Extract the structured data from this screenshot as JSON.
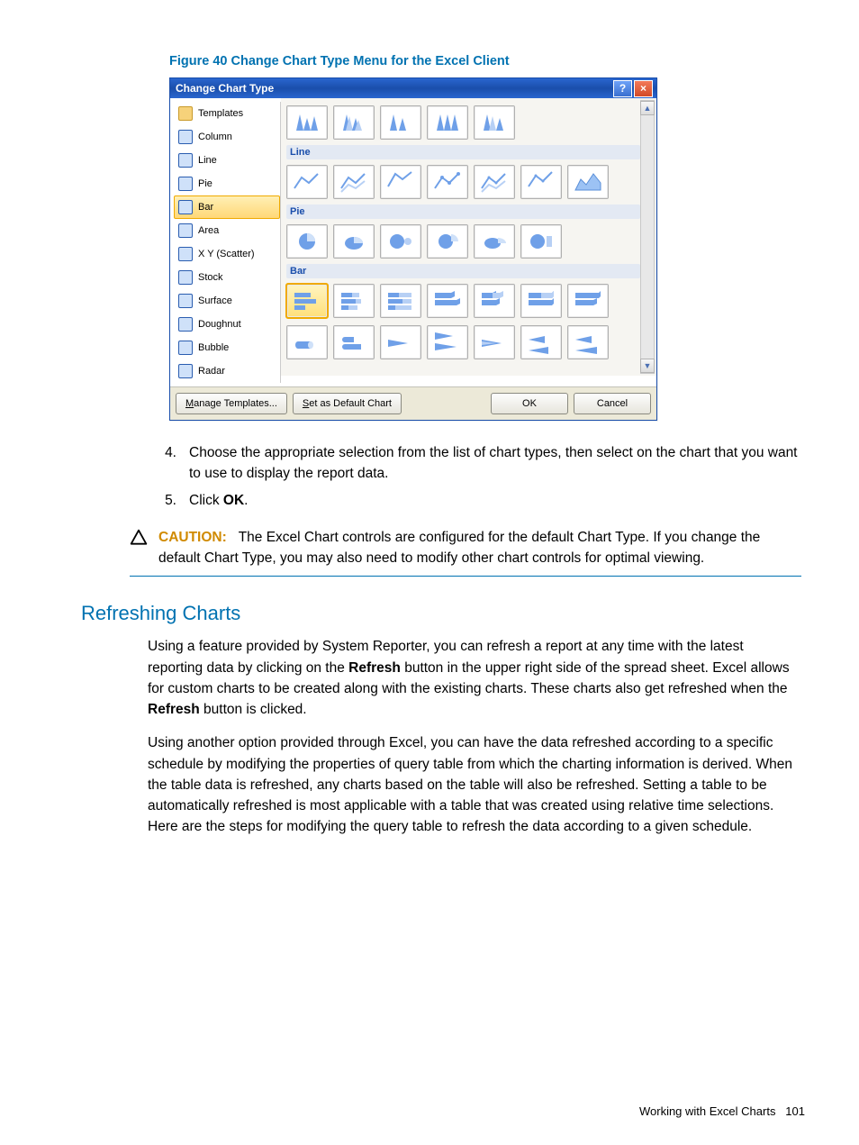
{
  "figure_caption": "Figure 40 Change Chart Type Menu for the Excel Client",
  "dialog": {
    "title": "Change Chart Type",
    "sidebar": {
      "items": [
        {
          "label": "Templates",
          "selected": false,
          "icon": "folder"
        },
        {
          "label": "Column",
          "selected": false,
          "icon": "column"
        },
        {
          "label": "Line",
          "selected": false,
          "icon": "line"
        },
        {
          "label": "Pie",
          "selected": false,
          "icon": "pie"
        },
        {
          "label": "Bar",
          "selected": true,
          "icon": "bar"
        },
        {
          "label": "Area",
          "selected": false,
          "icon": "area"
        },
        {
          "label": "X Y (Scatter)",
          "selected": false,
          "icon": "scatter"
        },
        {
          "label": "Stock",
          "selected": false,
          "icon": "stock"
        },
        {
          "label": "Surface",
          "selected": false,
          "icon": "surface"
        },
        {
          "label": "Doughnut",
          "selected": false,
          "icon": "doughnut"
        },
        {
          "label": "Bubble",
          "selected": false,
          "icon": "bubble"
        },
        {
          "label": "Radar",
          "selected": false,
          "icon": "radar"
        }
      ]
    },
    "groups": {
      "line": "Line",
      "pie": "Pie",
      "bar": "Bar"
    },
    "footer": {
      "manage": "Manage Templates...",
      "default": "Set as Default Chart",
      "ok": "OK",
      "cancel": "Cancel",
      "manage_m": "M",
      "default_s": "S"
    }
  },
  "steps": {
    "s4_num": "4.",
    "s4": "Choose the appropriate selection from the list of chart types, then select on the chart that you want to use to display the report data.",
    "s5_num": "5.",
    "s5_a": "Click ",
    "s5_b": "OK",
    "s5_c": "."
  },
  "caution": {
    "label": "CAUTION:",
    "body1": "The Excel Chart controls are configured for the default Chart Type. If you change the default Chart Type, you may also need to modify other chart controls for optimal viewing."
  },
  "heading": "Refreshing Charts",
  "p1_a": "Using a feature provided by System Reporter, you can refresh a report at any time with the latest reporting data by clicking on the ",
  "p1_b": "Refresh",
  "p1_c": " button in the upper right side of the spread sheet. Excel allows for custom charts to be created along with the existing charts. These charts also get refreshed when the ",
  "p1_d": "Refresh",
  "p1_e": " button is clicked.",
  "p2": "Using another option provided through Excel, you can have the data refreshed according to a specific schedule by modifying the properties of query table from which the charting information is derived. When the table data is refreshed, any charts based on the table will also be refreshed. Setting a table to be automatically refreshed is most applicable with a table that was created using relative time selections. Here are the steps for modifying the query table to refresh the data according to a given schedule.",
  "footer_text": "Working with Excel Charts",
  "footer_page": "101"
}
